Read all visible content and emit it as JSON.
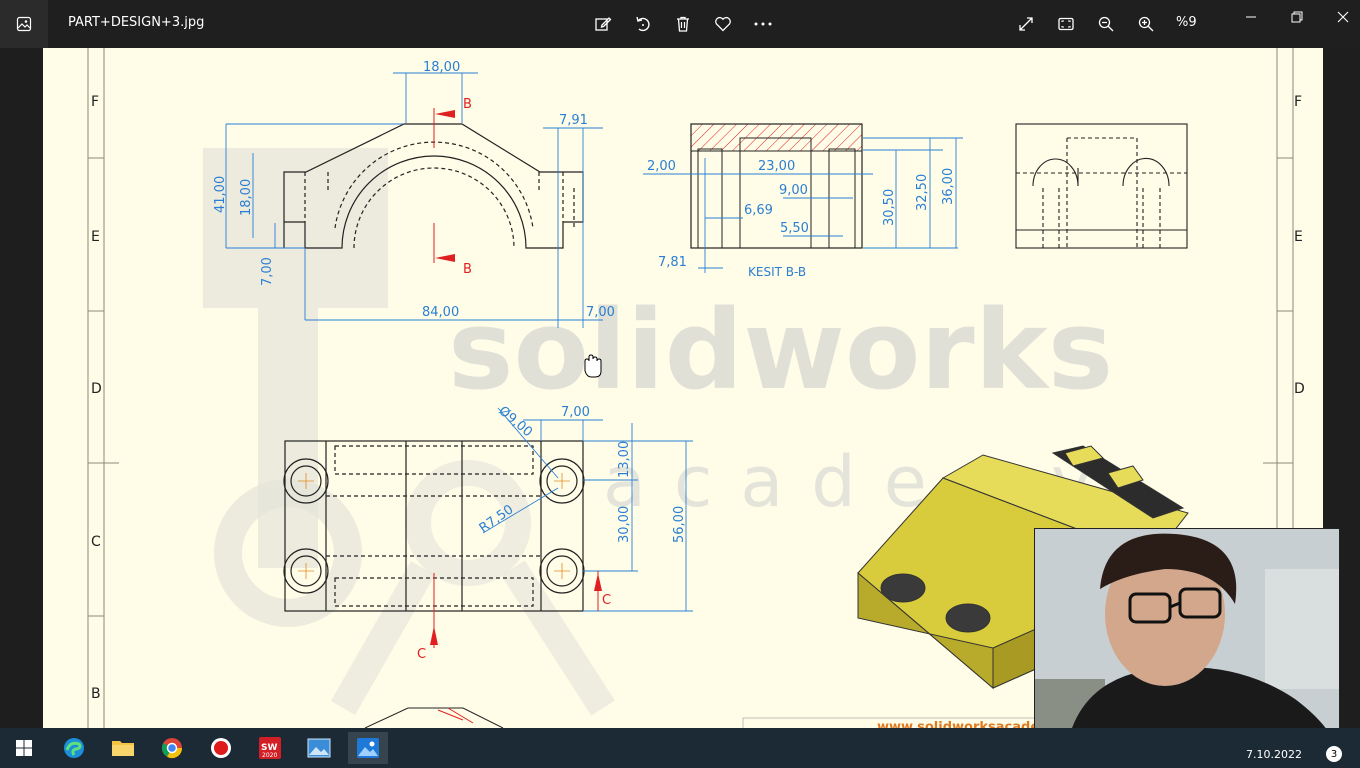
{
  "window": {
    "title": "PART+DESIGN+3.jpg",
    "zoom": "%9",
    "icons": [
      "edit-icon",
      "rotate-icon",
      "delete-icon",
      "favorite-icon",
      "more-icon",
      "fullscreen-icon",
      "fit-icon",
      "zoom-out-icon",
      "zoom-in-icon"
    ]
  },
  "drawing": {
    "row_labels": [
      "F",
      "E",
      "D",
      "C",
      "B"
    ],
    "dims_top": [
      "18,00",
      "7,91",
      "41,00",
      "18,00",
      "7,00",
      "84,00",
      "7,00"
    ],
    "section_marks": [
      "B",
      "B"
    ],
    "section_dims": [
      "2,00",
      "23,00",
      "9,00",
      "6,69",
      "5,50",
      "7,81",
      "30,50",
      "32,50",
      "36,00"
    ],
    "section_label": "KESIT B-B",
    "bottom_dims": [
      "Ø9,00",
      "7,00",
      "R7,50",
      "13,00",
      "30,00",
      "56,00"
    ],
    "c_marks": [
      "C",
      "C"
    ],
    "watermark_main": "solidworks",
    "watermark_sub": "academy",
    "footer_url": "www.solidworksacademy"
  },
  "taskbar": {
    "clock": "7.10.2022",
    "notification_count": "3",
    "apps": [
      "start",
      "edge",
      "file-explorer",
      "chrome",
      "recorder",
      "solidworks-2020",
      "photo-viewer",
      "photos"
    ]
  },
  "colors": {
    "titlebar": "#1f1f1f",
    "sheet": "#fffde8",
    "dimension": "#2a7fd4",
    "section_red": "#e02020",
    "part_yellow": "#e4d64a"
  }
}
